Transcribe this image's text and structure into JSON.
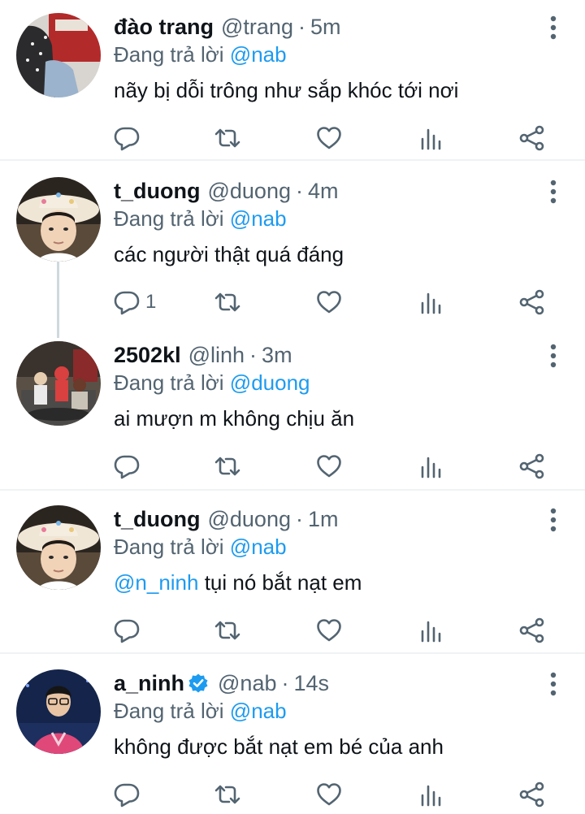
{
  "labels": {
    "replying_to": "Đang trả lời"
  },
  "colors": {
    "accent": "#1d9bf0",
    "secondary_text": "#536471",
    "divider": "#eff3f4"
  },
  "tweets": [
    {
      "name": "đào trang",
      "handle": "@trang",
      "time": "5m",
      "replying_to": "@nab",
      "mention": "",
      "text": "nãy bị dỗi trông như sắp khóc tới nơi",
      "reply_count": "",
      "verified": false,
      "avatar": "avatar-trang"
    },
    {
      "name": "t_duong",
      "handle": "@duong",
      "time": "4m",
      "replying_to": "@nab",
      "mention": "",
      "text": "các người thật quá đáng",
      "reply_count": "1",
      "verified": false,
      "avatar": "avatar-duong"
    },
    {
      "name": "2502kl",
      "handle": "@linh",
      "time": "3m",
      "replying_to": "@duong",
      "mention": "",
      "text": "ai mượn m không chịu ăn",
      "reply_count": "",
      "verified": false,
      "avatar": "avatar-linh"
    },
    {
      "name": "t_duong",
      "handle": "@duong",
      "time": "1m",
      "replying_to": "@nab",
      "mention": "@n_ninh",
      "text": " tụi nó bắt nạt em",
      "reply_count": "",
      "verified": false,
      "avatar": "avatar-duong"
    },
    {
      "name": "a_ninh",
      "handle": "@nab",
      "time": "14s",
      "replying_to": "@nab",
      "mention": "",
      "text": "không được bắt nạt em bé của anh",
      "reply_count": "",
      "verified": true,
      "avatar": "avatar-ninh"
    }
  ]
}
